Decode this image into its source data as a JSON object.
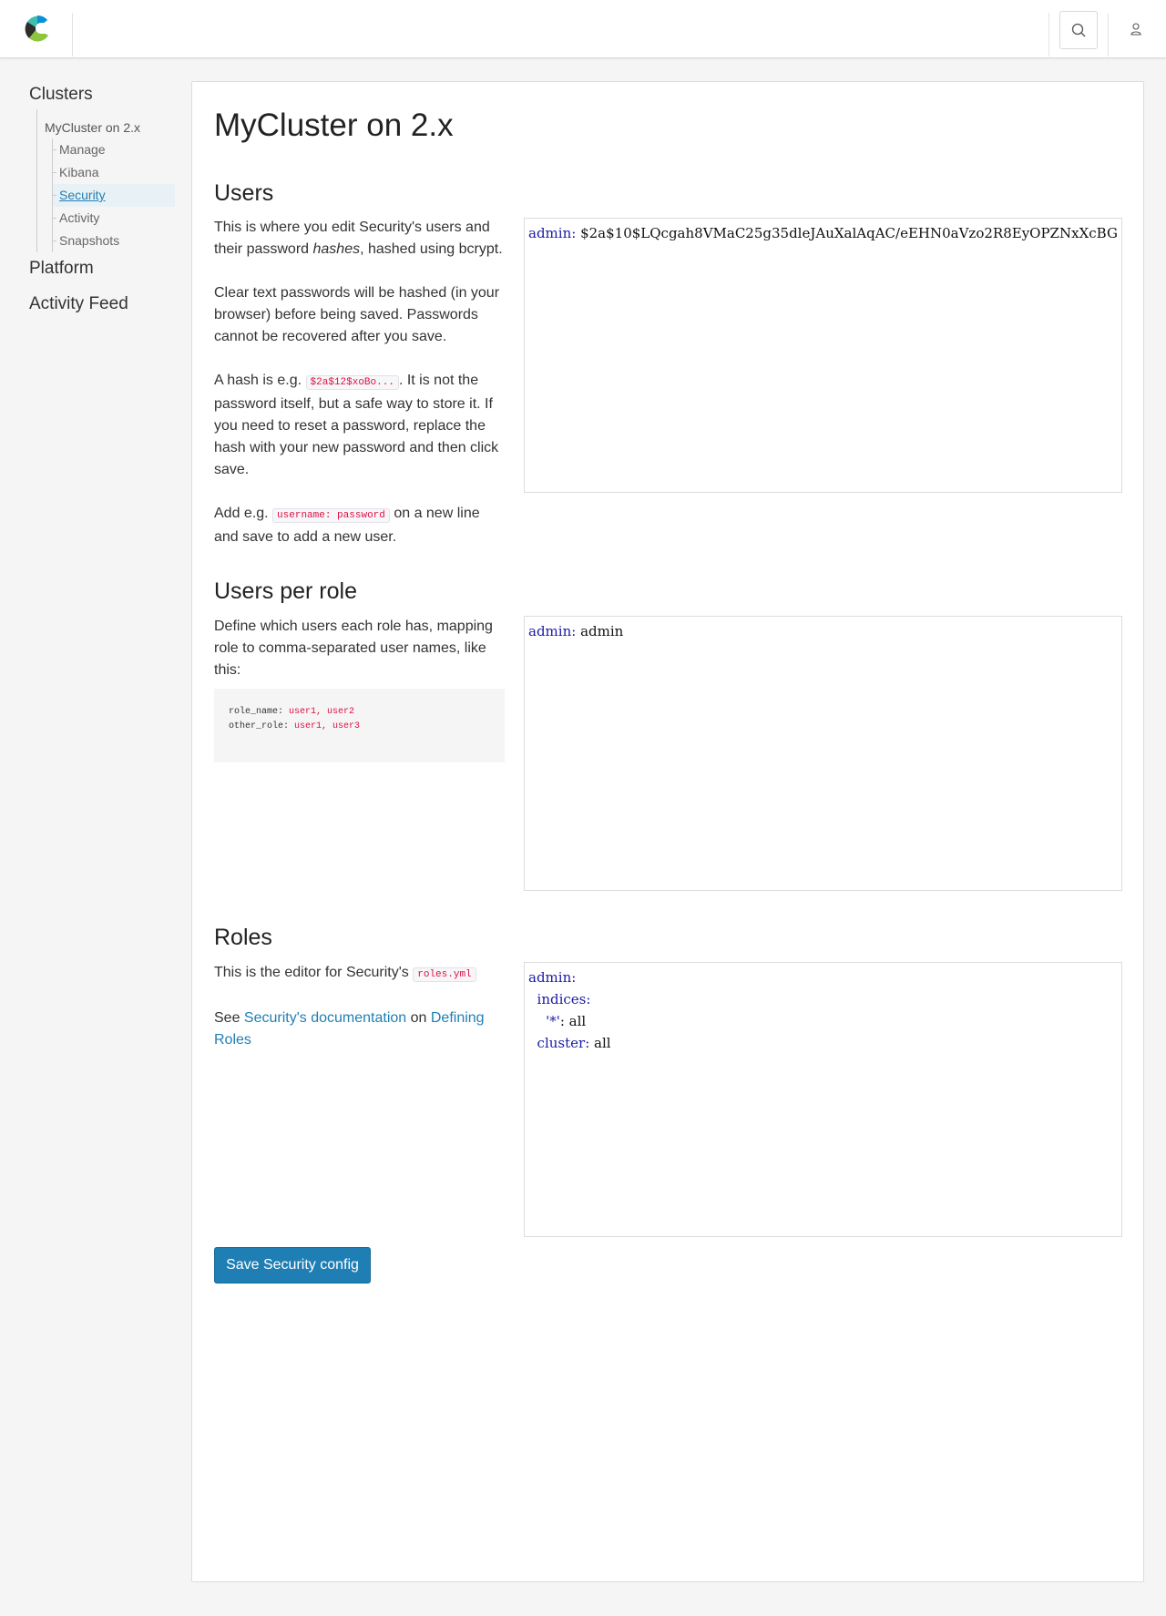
{
  "header": {
    "logo_name": "elastic-cloud-logo",
    "search_icon": "search-icon",
    "user_icon": "user-icon"
  },
  "sidebar": {
    "clusters_label": "Clusters",
    "cluster_name": "MyCluster on 2.x",
    "items": [
      {
        "label": "Manage"
      },
      {
        "label": "Kibana"
      },
      {
        "label": "Security",
        "active": true
      },
      {
        "label": "Activity"
      },
      {
        "label": "Snapshots"
      }
    ],
    "platform_label": "Platform",
    "activity_feed_label": "Activity Feed"
  },
  "main": {
    "title": "MyCluster on 2.x",
    "users": {
      "heading": "Users",
      "p1_a": "This is where you edit Security's users and their password ",
      "p1_em": "hashes",
      "p1_b": ", hashed using bcrypt.",
      "p2": "Clear text passwords will be hashed (in your browser) before being saved. Passwords cannot be recovered after you save.",
      "p3_a": "A hash is e.g. ",
      "p3_code": "$2a$12$xoBo...",
      "p3_b": ". It is not the password itself, but a safe way to store it. If you need to reset a password, replace the hash with your new password and then click save.",
      "p4_a": "Add e.g. ",
      "p4_code": "username: password",
      "p4_b": " on a new line and save to add a new user.",
      "editor_key": "admin",
      "editor_value": "$2a$10$LQcgah8VMaC25g35dleJAuXalAqAC/eEHN0aVzo2R8EyOPZNxXcBG"
    },
    "users_per_role": {
      "heading": "Users per role",
      "desc": "Define which users each role has, mapping role to comma-separated user names, like this:",
      "example_line1_key": "role_name: ",
      "example_line1_val": "user1, user2",
      "example_line2_key": "other_role: ",
      "example_line2_val": "user1, user3",
      "editor_key": "admin",
      "editor_value": "admin"
    },
    "roles": {
      "heading": "Roles",
      "desc_a": "This is the editor for Security's ",
      "desc_code": "roles.yml",
      "see": "See ",
      "doc_link": "Security's documentation",
      "on": " on ",
      "defining_link": "Defining Roles",
      "editor_l1_key": "admin",
      "editor_l2_key": "indices",
      "editor_l3_key": "'*'",
      "editor_l3_val": "all",
      "editor_l4_key": "cluster",
      "editor_l4_val": "all"
    },
    "save_button": "Save Security config"
  }
}
